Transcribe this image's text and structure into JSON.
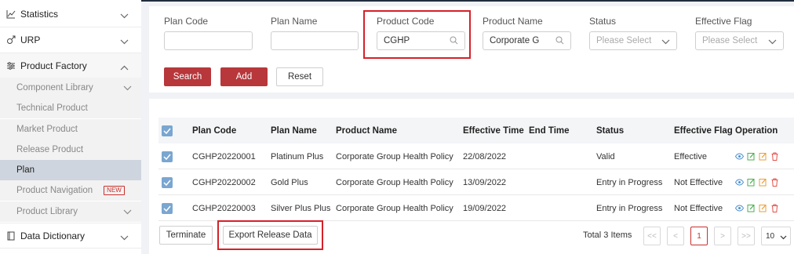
{
  "sidebar": {
    "groups": [
      {
        "label": "Statistics",
        "icon": "chart-line-icon"
      },
      {
        "label": "URP",
        "icon": "gender-icon"
      },
      {
        "label": "Product Factory",
        "icon": "sliders-icon"
      },
      {
        "label": "Data Dictionary",
        "icon": "book-icon"
      }
    ],
    "sub_items": [
      {
        "label": "Component Library"
      },
      {
        "label": "Technical Product"
      },
      {
        "label": "Market Product"
      },
      {
        "label": "Release Product"
      },
      {
        "label": "Plan"
      },
      {
        "label": "Product Navigation",
        "badge": "NEW"
      },
      {
        "label": "Product Library"
      }
    ]
  },
  "filters": {
    "plan_code": {
      "label": "Plan Code",
      "value": ""
    },
    "plan_name": {
      "label": "Plan Name",
      "value": ""
    },
    "product_code": {
      "label": "Product Code",
      "value": "CGHP"
    },
    "product_name": {
      "label": "Product Name",
      "value": "Corporate G"
    },
    "status": {
      "label": "Status",
      "placeholder": "Please Select"
    },
    "effective_flag": {
      "label": "Effective Flag",
      "placeholder": "Please Select"
    },
    "buttons": {
      "search": "Search",
      "add": "Add",
      "reset": "Reset"
    }
  },
  "table": {
    "columns": [
      "Plan Code",
      "Plan Name",
      "Product Name",
      "Effective Time",
      "End Time",
      "Status",
      "Effective Flag",
      "Operation"
    ],
    "rows": [
      {
        "plan_code": "CGHP20220001",
        "plan_name": "Platinum Plus",
        "product_name": "Corporate Group Health Policy",
        "effective_time": "22/08/2022",
        "end_time": "",
        "status": "Valid",
        "effective_flag": "Effective"
      },
      {
        "plan_code": "CGHP20220002",
        "plan_name": "Gold Plus",
        "product_name": "Corporate Group Health Policy",
        "effective_time": "13/09/2022",
        "end_time": "",
        "status": "Entry in Progress",
        "effective_flag": "Not Effective"
      },
      {
        "plan_code": "CGHP20220003",
        "plan_name": "Silver Plus Plus",
        "product_name": "Corporate Group Health Policy",
        "effective_time": "19/09/2022",
        "end_time": "",
        "status": "Entry in Progress",
        "effective_flag": "Not Effective"
      }
    ]
  },
  "footer": {
    "terminate": "Terminate",
    "export": "Export Release Data",
    "total": "Total 3 Items",
    "pager": {
      "first": "<<",
      "prev": "<",
      "current": "1",
      "next": ">",
      "last": ">>",
      "page_size": "10"
    }
  },
  "colors": {
    "accent": "#b7373b",
    "highlight": "#d6212a",
    "checkbox": "#7aa6d1",
    "active_nav": "#cfd5de"
  }
}
